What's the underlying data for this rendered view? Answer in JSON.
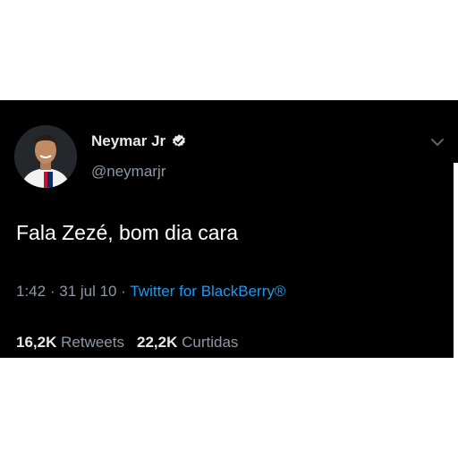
{
  "tweet": {
    "author": {
      "name": "Neymar Jr",
      "handle": "@neymarjr",
      "verified": true
    },
    "text": "Fala Zezé, bom dia cara",
    "time": "1:42",
    "date": "31 jul 10",
    "separator": "·",
    "source": "Twitter for BlackBerry®",
    "retweets_count": "16,2K",
    "retweets_label": "Retweets",
    "likes_count": "22,2K",
    "likes_label": "Curtidas"
  },
  "icons": {
    "verified": "verified-badge-icon",
    "menu": "chevron-down-icon"
  },
  "colors": {
    "background": "#000000",
    "link": "#1d9bf0",
    "secondary_text": "#8b98a5",
    "primary_text": "#e7e9ea"
  }
}
